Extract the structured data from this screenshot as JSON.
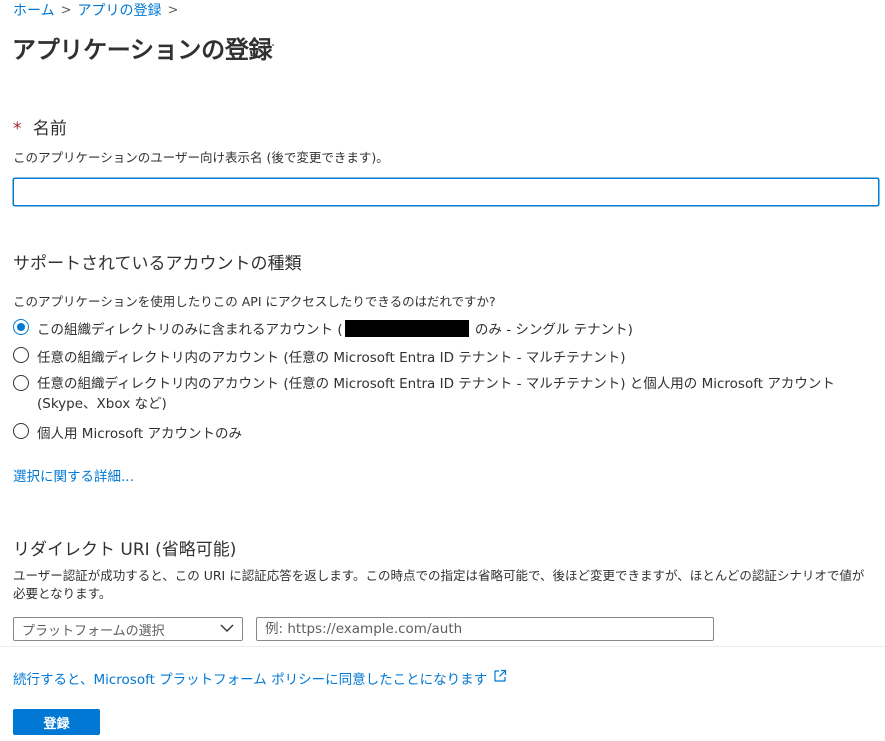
{
  "breadcrumb": {
    "home": "ホーム",
    "sep1": ">",
    "app_reg": "アプリの登録",
    "sep2": ">"
  },
  "page": {
    "title": "アプリケーションの登録",
    "more_label": "···"
  },
  "name_section": {
    "required_mark": "*",
    "label": "名前",
    "description": "このアプリケーションのユーザー向け表示名 (後で変更できます)。",
    "value": ""
  },
  "account_section": {
    "label": "サポートされているアカウントの種類",
    "question": "このアプリケーションを使用したりこの API にアクセスしたりできるのはだれですか?",
    "options": [
      {
        "label_before": "この組織ディレクトリのみに含まれるアカウント (",
        "label_after": " のみ - シングル テナント)",
        "selected": true
      },
      {
        "label": "任意の組織ディレクトリ内のアカウント (任意の Microsoft Entra ID テナント - マルチテナント)",
        "selected": false
      },
      {
        "label": "任意の組織ディレクトリ内のアカウント (任意の Microsoft Entra ID テナント - マルチテナント) と個人用の Microsoft アカウント (Skype、Xbox など)",
        "selected": false
      },
      {
        "label": "個人用 Microsoft アカウントのみ",
        "selected": false
      }
    ],
    "more_info_link": "選択に関する詳細..."
  },
  "redirect_section": {
    "label": "リダイレクト URI (省略可能)",
    "description": "ユーザー認証が成功すると、この URI に認証応答を返します。この時点での指定は省略可能で、後ほど変更できますが、ほとんどの認証シナリオで値が必要となります。",
    "platform_select": "プラットフォームの選択",
    "uri_placeholder": "例: https://example.com/auth"
  },
  "footer": {
    "policy_text": "続行すると、Microsoft プラットフォーム ポリシーに同意したことになります",
    "register_button": "登録"
  },
  "colors": {
    "accent": "#0078d4",
    "required": "#a4262c",
    "text": "#323130"
  }
}
